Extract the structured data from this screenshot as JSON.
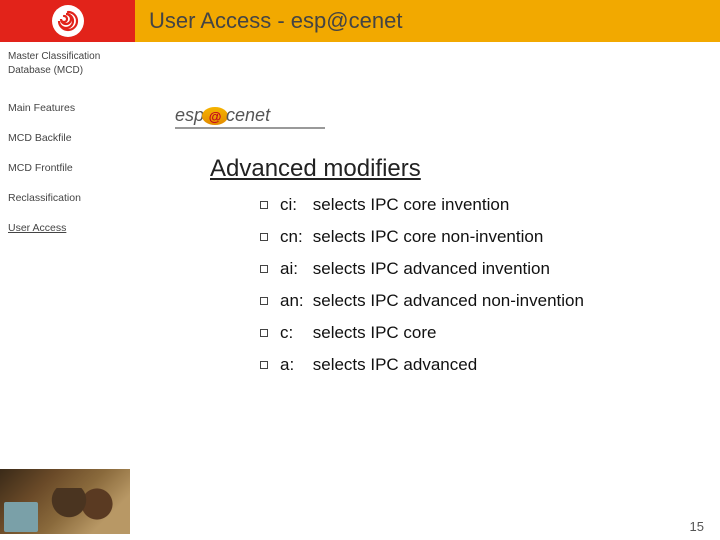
{
  "header": {
    "title": "User Access - esp@cenet"
  },
  "sidebar": {
    "title_line1": "Master Classification",
    "title_line2": "Database (MCD)",
    "items": [
      {
        "label": "Main Features"
      },
      {
        "label": "MCD Backfile"
      },
      {
        "label": "MCD Frontfile"
      },
      {
        "label": "Reclassification"
      },
      {
        "label": "User Access"
      }
    ],
    "active_index": 4
  },
  "brand": {
    "prefix": "esp",
    "at": "@",
    "mid": "ce",
    "suffix": "net"
  },
  "section": {
    "heading": "Advanced modifiers"
  },
  "modifiers": [
    {
      "key": "ci:",
      "desc": "selects IPC core invention"
    },
    {
      "key": "cn:",
      "desc": "selects IPC core non-invention"
    },
    {
      "key": "ai:",
      "desc": "selects IPC advanced invention"
    },
    {
      "key": "an:",
      "desc": "selects IPC advanced non-invention"
    },
    {
      "key": "c:",
      "desc": "selects IPC core"
    },
    {
      "key": "a:",
      "desc": "selects IPC advanced"
    }
  ],
  "page_number": "15"
}
